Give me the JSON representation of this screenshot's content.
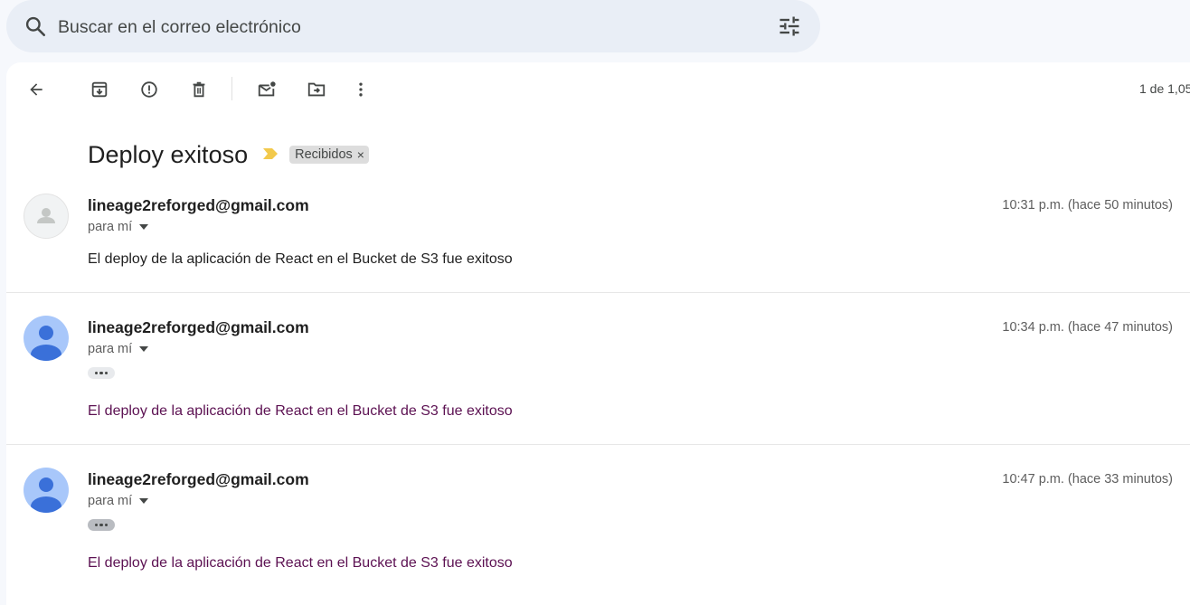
{
  "search": {
    "placeholder": "Buscar en el correo electrónico",
    "search_icon": "search-icon",
    "options_icon": "tune-icon"
  },
  "toolbar": {
    "icons": [
      "arrow-back-icon",
      "archive-icon",
      "report-spam-icon",
      "delete-icon",
      "mark-unread-icon",
      "move-to-icon",
      "more-vert-icon"
    ],
    "pagination": "1 de 1,05"
  },
  "thread": {
    "subject": "Deploy exitoso",
    "label": "Recibidos",
    "label_remove": "×",
    "important_color": "#f2c94c",
    "messages": [
      {
        "sender": "lineage2reforged@gmail.com",
        "time": "10:31 p.m. (hace 50 minutos)",
        "recipients": "para mí",
        "body": "El deploy de la aplicación de React en el Bucket de S3 fue exitoso",
        "avatar": "default-gray-avatar"
      },
      {
        "sender": "lineage2reforged@gmail.com",
        "time": "10:34 p.m. (hace 47 minutos)",
        "recipients": "para mí",
        "body": "El deploy de la aplicación de React en el Bucket de S3 fue exitoso",
        "avatar": "default-blue-avatar"
      },
      {
        "sender": "lineage2reforged@gmail.com",
        "time": "10:47 p.m. (hace 33 minutos)",
        "recipients": "para mí",
        "body": "El deploy de la aplicación de React en el Bucket de S3 fue exitoso",
        "avatar": "default-blue-avatar"
      }
    ]
  },
  "colors": {
    "avatar_blue_bg": "#a8c7fa",
    "avatar_blue_fg": "#3a70d9",
    "visited_text": "#5c1152"
  }
}
